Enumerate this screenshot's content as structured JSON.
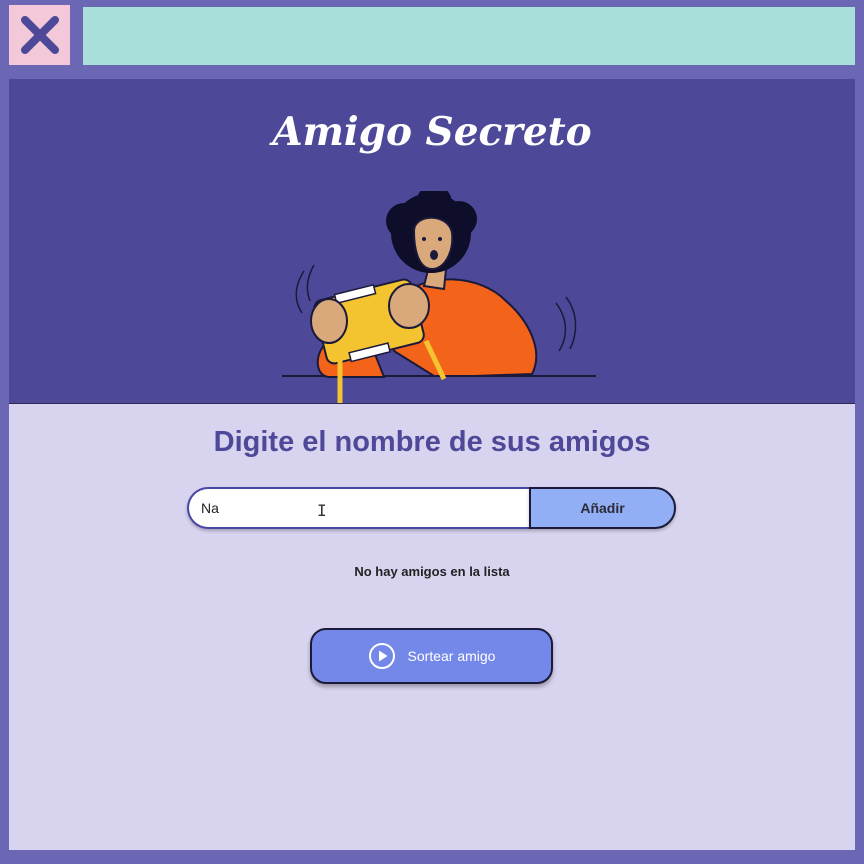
{
  "app": {
    "close_icon": "close-x-icon",
    "colors": {
      "frame": "#6b67b5",
      "top_bar": "#a8dfda",
      "close_box": "#f3c8d9",
      "header_bg": "#4e4898",
      "content_bg": "#d8d4ef",
      "add_button_bg": "#92aef5",
      "draw_button_bg": "#7388e8"
    }
  },
  "header": {
    "title": "Amigo Secreto",
    "illustration": "person-playing-handheld-console-illustration"
  },
  "main": {
    "subtitle": "Digite el nombre de sus amigos",
    "name_input": {
      "value": "Na",
      "placeholder": ""
    },
    "add_button_label": "Añadir",
    "empty_list_message": "No hay amigos en la lista",
    "draw_button": {
      "label": "Sortear amigo",
      "icon": "play-circle-icon"
    }
  }
}
